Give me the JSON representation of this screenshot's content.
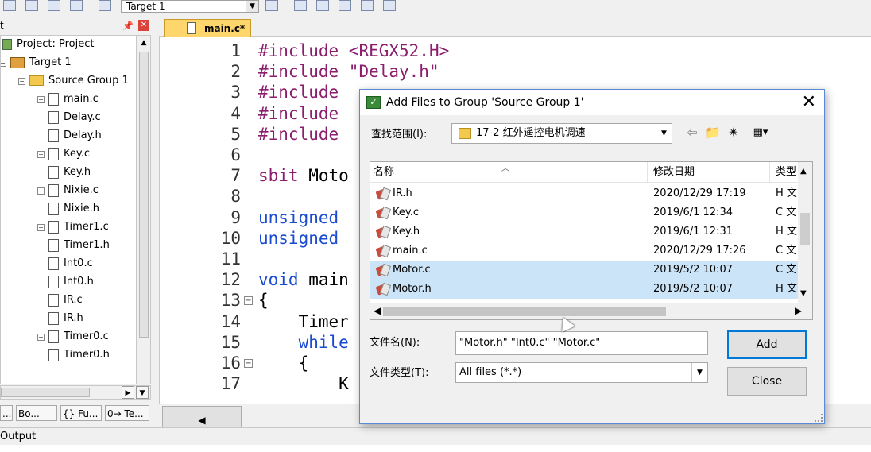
{
  "toolbar": {
    "target": "Target 1"
  },
  "project_panel": {
    "title_fragment": "t",
    "tree": [
      {
        "label": "Project: Project",
        "kind": "project",
        "level": 0
      },
      {
        "label": "Target 1",
        "kind": "target",
        "level": 1
      },
      {
        "label": "Source Group 1",
        "kind": "folder",
        "level": 2
      },
      {
        "label": "main.c",
        "kind": "file",
        "level": 3,
        "expandable": true
      },
      {
        "label": "Delay.c",
        "kind": "file",
        "level": 3,
        "expandable": false
      },
      {
        "label": "Delay.h",
        "kind": "file",
        "level": 3,
        "expandable": false
      },
      {
        "label": "Key.c",
        "kind": "file",
        "level": 3,
        "expandable": true
      },
      {
        "label": "Key.h",
        "kind": "file",
        "level": 3,
        "expandable": false
      },
      {
        "label": "Nixie.c",
        "kind": "file",
        "level": 3,
        "expandable": true
      },
      {
        "label": "Nixie.h",
        "kind": "file",
        "level": 3,
        "expandable": false
      },
      {
        "label": "Timer1.c",
        "kind": "file",
        "level": 3,
        "expandable": true
      },
      {
        "label": "Timer1.h",
        "kind": "file",
        "level": 3,
        "expandable": false
      },
      {
        "label": "Int0.c",
        "kind": "file",
        "level": 3,
        "expandable": false
      },
      {
        "label": "Int0.h",
        "kind": "file",
        "level": 3,
        "expandable": false
      },
      {
        "label": "IR.c",
        "kind": "file",
        "level": 3,
        "expandable": false
      },
      {
        "label": "IR.h",
        "kind": "file",
        "level": 3,
        "expandable": false
      },
      {
        "label": "Timer0.c",
        "kind": "file",
        "level": 3,
        "expandable": true
      },
      {
        "label": "Timer0.h",
        "kind": "file",
        "level": 3,
        "expandable": false
      }
    ],
    "bottom_tabs": [
      "...",
      "Bo...",
      "{} Fu...",
      "0→ Te..."
    ]
  },
  "editor": {
    "tab": "main.c*",
    "lines": [
      {
        "n": "1",
        "parts": [
          [
            "pp",
            "#include "
          ],
          [
            "str",
            "<REGX52.H>"
          ]
        ]
      },
      {
        "n": "2",
        "parts": [
          [
            "pp",
            "#include "
          ],
          [
            "str",
            "\"Delay.h\""
          ]
        ]
      },
      {
        "n": "3",
        "parts": [
          [
            "pp",
            "#include"
          ]
        ]
      },
      {
        "n": "4",
        "parts": [
          [
            "pp",
            "#include"
          ]
        ]
      },
      {
        "n": "5",
        "parts": [
          [
            "pp",
            "#include"
          ]
        ]
      },
      {
        "n": "6",
        "parts": []
      },
      {
        "n": "7",
        "parts": [
          [
            "pp",
            "sbit "
          ],
          [
            "txt",
            "Moto"
          ]
        ]
      },
      {
        "n": "8",
        "parts": []
      },
      {
        "n": "9",
        "parts": [
          [
            "kw",
            "unsigned"
          ]
        ]
      },
      {
        "n": "10",
        "parts": [
          [
            "kw",
            "unsigned"
          ]
        ]
      },
      {
        "n": "11",
        "parts": []
      },
      {
        "n": "12",
        "parts": [
          [
            "kw",
            "void "
          ],
          [
            "txt",
            "main"
          ]
        ]
      },
      {
        "n": "13",
        "parts": [
          [
            "txt",
            "{"
          ]
        ],
        "fold": "−"
      },
      {
        "n": "14",
        "parts": [
          [
            "txt",
            "    Timer"
          ]
        ]
      },
      {
        "n": "15",
        "parts": [
          [
            "kw",
            "    while"
          ]
        ]
      },
      {
        "n": "16",
        "parts": [
          [
            "txt",
            "    {"
          ]
        ],
        "fold": "−"
      },
      {
        "n": "17",
        "parts": [
          [
            "txt",
            "        K"
          ]
        ]
      }
    ]
  },
  "output_label": "Output",
  "dialog": {
    "title": "Add Files to Group 'Source Group 1'",
    "look_in_label": "查找范围(I):",
    "look_in_value": "17-2 红外遥控电机调速",
    "columns": [
      "名称",
      "修改日期",
      "类型"
    ],
    "files": [
      {
        "name": "IR.h",
        "date": "2020/12/29 17:19",
        "type": "H 文",
        "selected": false
      },
      {
        "name": "Key.c",
        "date": "2019/6/1 12:34",
        "type": "C 文",
        "selected": false
      },
      {
        "name": "Key.h",
        "date": "2019/6/1 12:31",
        "type": "H 文",
        "selected": false
      },
      {
        "name": "main.c",
        "date": "2020/12/29 17:26",
        "type": "C 文",
        "selected": false
      },
      {
        "name": "Motor.c",
        "date": "2019/5/2 10:07",
        "type": "C 文",
        "selected": true
      },
      {
        "name": "Motor.h",
        "date": "2019/5/2 10:07",
        "type": "H 文",
        "selected": true
      }
    ],
    "filename_label": "文件名(N):",
    "filename_value": "\"Motor.h\" \"Int0.c\" \"Motor.c\"",
    "filetype_label": "文件类型(T):",
    "filetype_value": "All files (*.*)",
    "add_label": "Add",
    "close_label": "Close"
  }
}
